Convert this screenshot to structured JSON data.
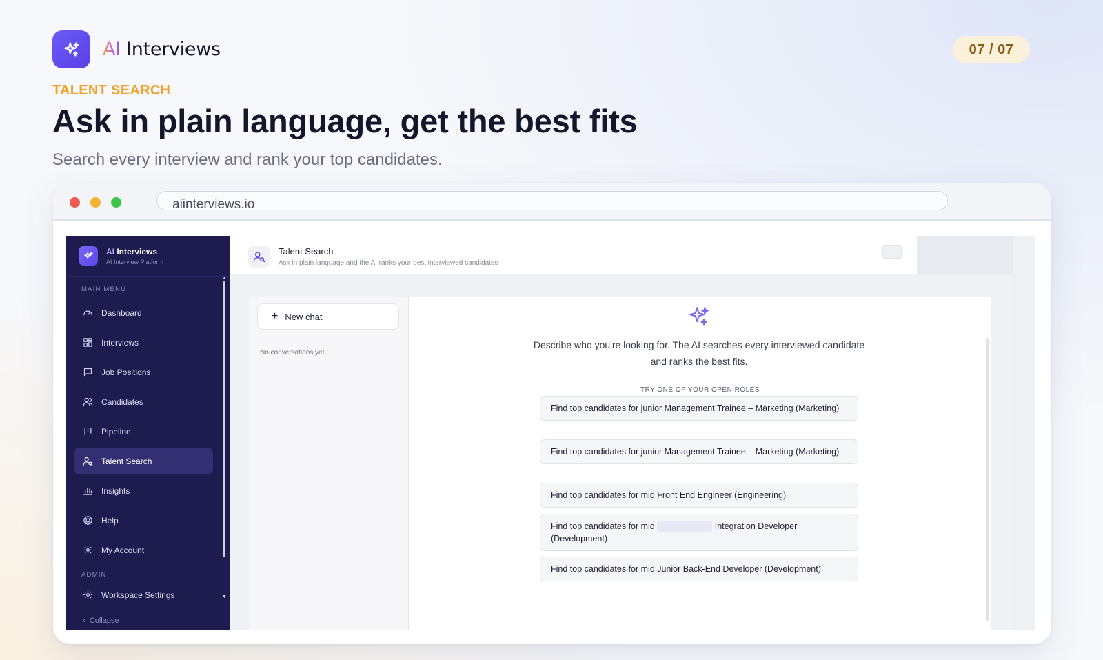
{
  "brand": {
    "ai": "AI",
    "name": " Interviews"
  },
  "pager": "07 / 07",
  "eyebrow": "TALENT SEARCH",
  "headline": "Ask in plain language, get the best fits",
  "subhead": "Search every interview and rank your top candidates.",
  "browser": {
    "url": "aiinterviews.io"
  },
  "sidebar": {
    "brand_ai": "AI",
    "brand_name": " Interviews",
    "brand_sub": "AI Interview Platform",
    "main_menu_label": "MAIN MENU",
    "admin_label": "ADMIN",
    "items": [
      {
        "label": "Dashboard",
        "icon": "gauge-icon"
      },
      {
        "label": "Interviews",
        "icon": "grid-icon"
      },
      {
        "label": "Job Positions",
        "icon": "message-square-icon"
      },
      {
        "label": "Candidates",
        "icon": "users-icon"
      },
      {
        "label": "Pipeline",
        "icon": "pipeline-icon"
      },
      {
        "label": "Talent Search",
        "icon": "user-search-icon",
        "active": true
      },
      {
        "label": "Insights",
        "icon": "bar-chart-icon"
      },
      {
        "label": "Help",
        "icon": "lifebuoy-icon"
      },
      {
        "label": "My Account",
        "icon": "gear-icon"
      }
    ],
    "admin_items": [
      {
        "label": "Workspace Settings",
        "icon": "gear-icon"
      }
    ],
    "collapse_label": "Collapse"
  },
  "topbar": {
    "title": "Talent Search",
    "subtitle": "Ask in plain language and the AI ranks your best interviewed candidates"
  },
  "chat_list": {
    "new_chat_label": "New chat",
    "empty_text": "No conversations yet."
  },
  "chat": {
    "intro": "Describe who you're looking for. The AI searches every interviewed candidate and ranks the best fits.",
    "try_label": "TRY ONE OF YOUR OPEN ROLES",
    "suggestions": [
      "Find top candidates for junior Management Trainee – Marketing (Marketing)",
      "Find top candidates for junior Management Trainee – Marketing (Marketing)",
      "Find top candidates for mid Front End Engineer (Engineering)",
      {
        "before": "Find top candidates for mid",
        "after": "Integration Developer (Development)"
      },
      "Find top candidates for mid Junior Back-End Developer (Development)"
    ]
  },
  "colors": {
    "accent": "#5a3fe6",
    "sidebar_bg": "#1e1b4f",
    "eyebrow": "#f0a22d"
  }
}
